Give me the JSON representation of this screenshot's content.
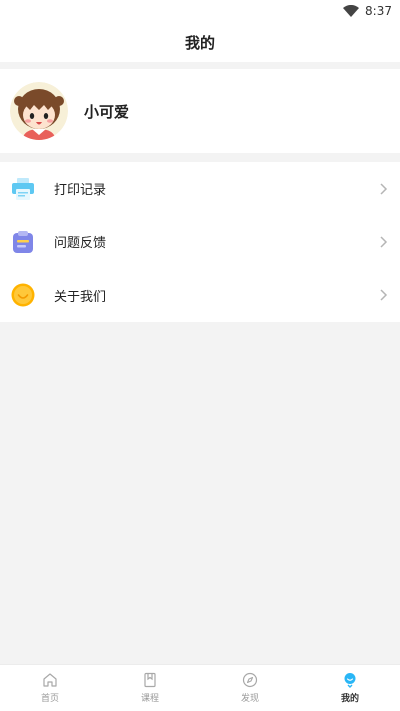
{
  "status_bar": {
    "time": "8:37",
    "wifi_icon": "wifi-icon"
  },
  "header": {
    "title": "我的"
  },
  "profile": {
    "username": "小可爱",
    "avatar_icon": "cartoon-girl-avatar"
  },
  "menu": {
    "items": [
      {
        "label": "打印记录",
        "icon": "printer-icon",
        "color": "#5ec8f2"
      },
      {
        "label": "问题反馈",
        "icon": "clipboard-icon",
        "color": "#7f86e8"
      },
      {
        "label": "关于我们",
        "icon": "smiley-icon",
        "color": "#ffb300"
      }
    ]
  },
  "bottom_nav": {
    "items": [
      {
        "label": "首页",
        "icon": "home-icon"
      },
      {
        "label": "课程",
        "icon": "book-icon"
      },
      {
        "label": "发现",
        "icon": "compass-icon"
      },
      {
        "label": "我的",
        "icon": "profile-icon"
      }
    ],
    "active_index": 3,
    "active_color": "#29b6f6"
  }
}
